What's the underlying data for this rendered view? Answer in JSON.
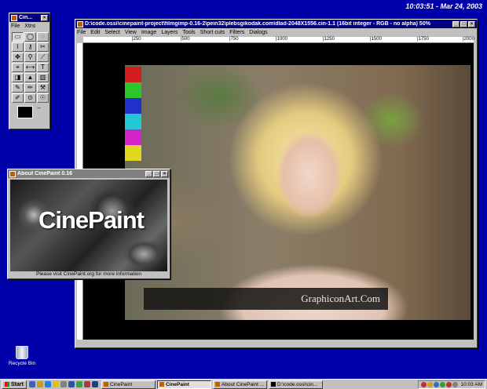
{
  "clock": "10:03:51 - Mar 24, 2003",
  "toolbox": {
    "title": "Cin...",
    "menu": [
      "File",
      "Xtns"
    ],
    "tools": [
      "▭",
      "◯",
      "◌",
      "⌇",
      "⚷",
      "✂",
      "✥",
      "⚲",
      "⟋",
      "⌖",
      "⟷",
      "T",
      "◨",
      "▲",
      "▥",
      "✎",
      "✏",
      "⚒",
      "✐",
      "⊙",
      "☉"
    ]
  },
  "image_window": {
    "title": "D:\\code.ossi\\cinepaint-project\\filmgimp-0.16-2\\pein32\\plebsgikodak.com\\dlad-2048X1556.cin-1.1 (16bit integer - RGB - no alpha) 50%",
    "menu": [
      "File",
      "Edit",
      "Select",
      "View",
      "Image",
      "Layers",
      "Tools",
      "Short cuts",
      "Filters",
      "Dialogs"
    ],
    "ruler_ticks": [
      "|250",
      "|500",
      "|750",
      "|1000",
      "|1250",
      "|1500",
      "|1750",
      "|2000"
    ],
    "color_chips": [
      "#d21e1e",
      "#2cc52c",
      "#2030c8",
      "#22c8d2",
      "#d222c8",
      "#e0d81e"
    ],
    "watermark": "GraphiconArt.Com"
  },
  "about": {
    "title": "About CinePaint 0.16",
    "logo": "CinePaint",
    "message": "Please visit CinePaint.org for more information"
  },
  "desktop": {
    "recycle_bin": "Recycle Bin"
  },
  "taskbar": {
    "start": "Start",
    "tasks": [
      "CinePaint",
      "CinePaint",
      "About CinePaint ...",
      "D:\\code.ossi\\cin..."
    ],
    "time": "10:03 AM"
  }
}
